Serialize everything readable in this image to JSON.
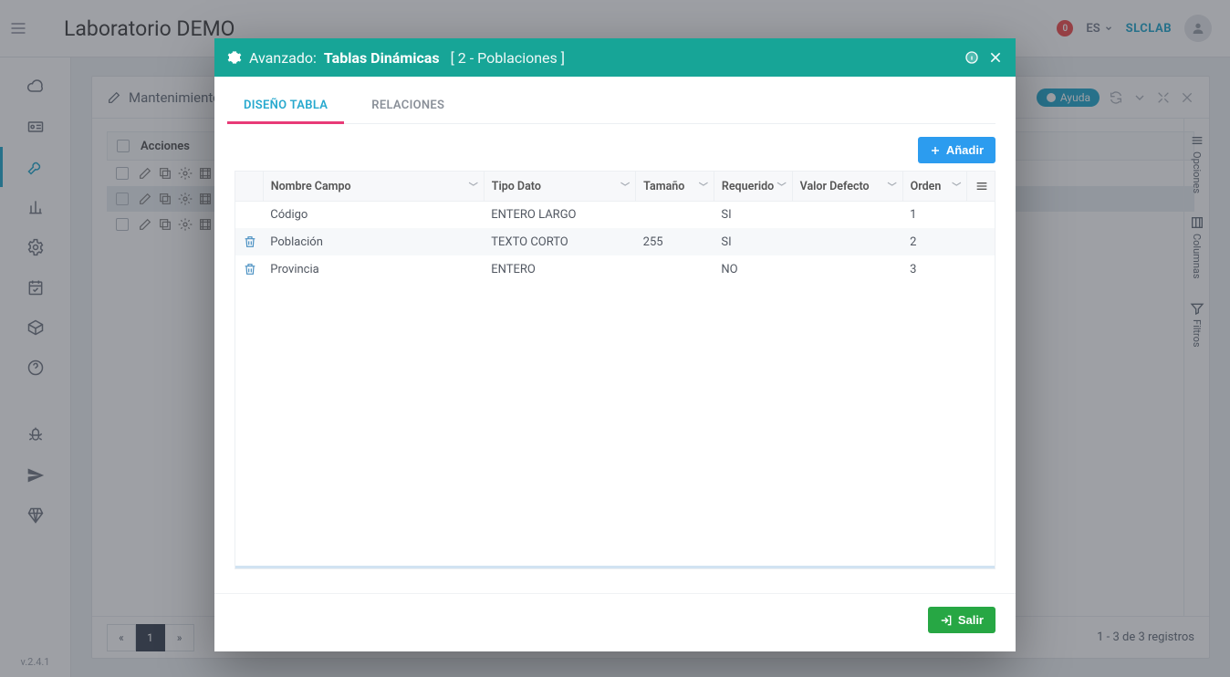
{
  "topbar": {
    "brand": "Laboratorio DEMO",
    "badge": "0",
    "lang": "ES",
    "user": "SLCLAB"
  },
  "sidenav": {
    "version": "v.2.4.1"
  },
  "panel": {
    "title": "Mantenimiento",
    "help_pill": "Ayuda",
    "grid_actions_header": "Acciones",
    "records_text": "1 - 3 de 3 registros",
    "page_current": "1",
    "opts": {
      "opciones": "Opciones",
      "columnas": "Columnas",
      "filtros": "Filtros"
    }
  },
  "modal": {
    "title_prefix": "Avanzado:",
    "title_main": "Tablas Dinámicas",
    "title_bracket": "[ 2 - Poblaciones ]",
    "tabs": {
      "design": "DISEÑO TABLA",
      "relations": "RELACIONES"
    },
    "add_button": "Añadir",
    "exit_button": "Salir",
    "columns": {
      "nombre": "Nombre Campo",
      "tipo": "Tipo Dato",
      "tamano": "Tamaño",
      "requerido": "Requerido",
      "defecto": "Valor Defecto",
      "orden": "Orden"
    },
    "rows": [
      {
        "deletable": false,
        "nombre": "Código",
        "tipo": "ENTERO LARGO",
        "tamano": "",
        "requerido": "SI",
        "defecto": "",
        "orden": "1"
      },
      {
        "deletable": true,
        "nombre": "Población",
        "tipo": "TEXTO CORTO",
        "tamano": "255",
        "requerido": "SI",
        "defecto": "",
        "orden": "2"
      },
      {
        "deletable": true,
        "nombre": "Provincia",
        "tipo": "ENTERO",
        "tamano": "",
        "requerido": "NO",
        "defecto": "",
        "orden": "3"
      }
    ]
  }
}
